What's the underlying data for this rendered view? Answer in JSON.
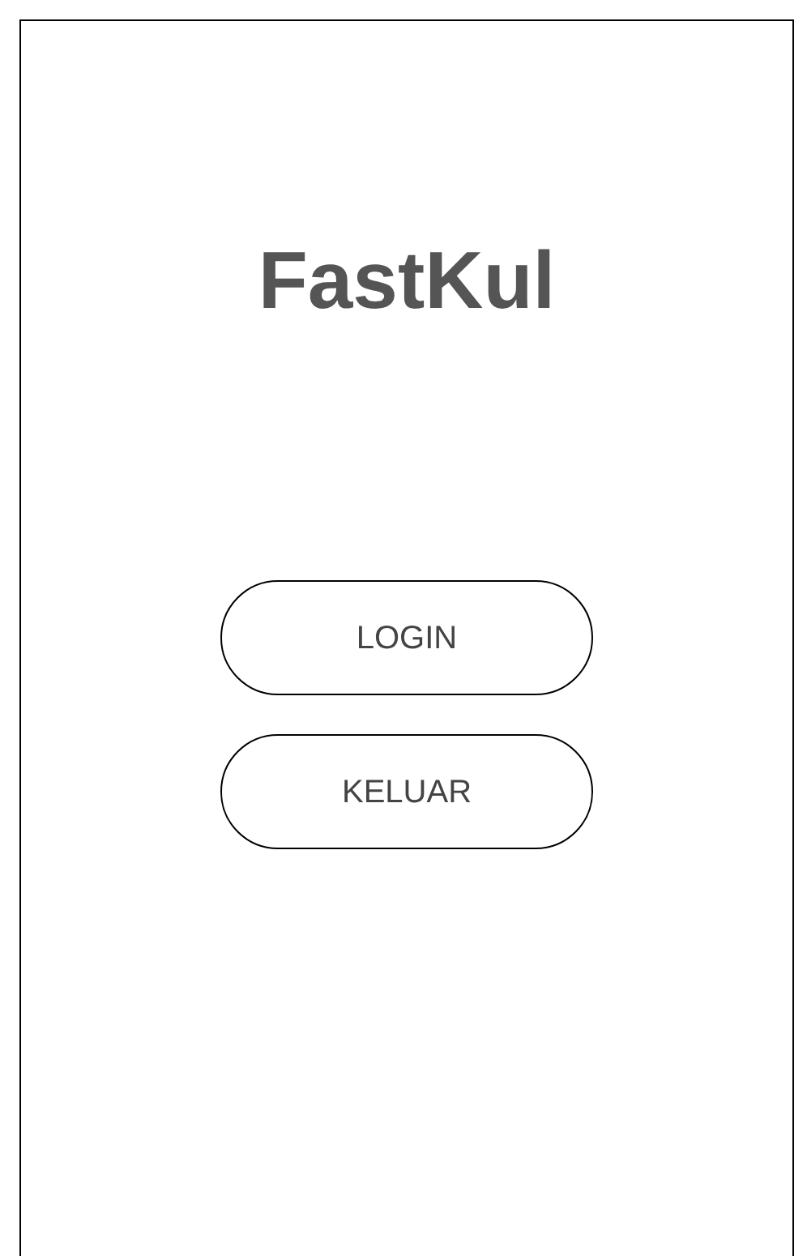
{
  "title": "FastKul",
  "buttons": [
    {
      "label": "LOGIN"
    },
    {
      "label": "KELUAR"
    }
  ]
}
